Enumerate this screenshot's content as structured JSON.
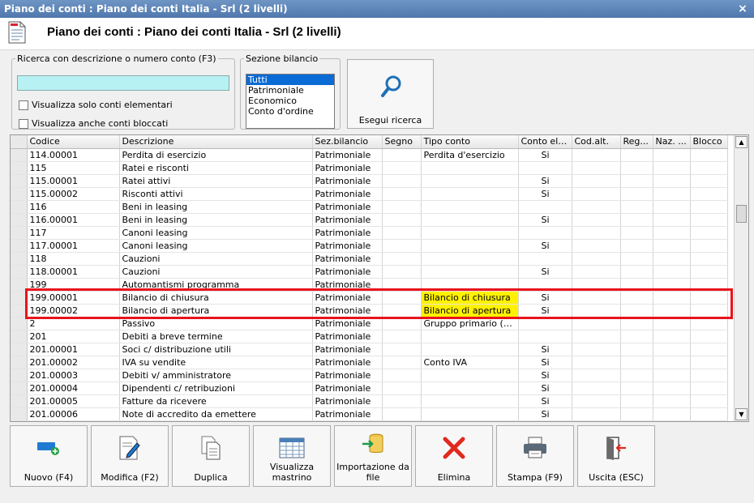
{
  "window": {
    "title": "Piano dei conti : Piano dei conti Italia - Srl (2 livelli)",
    "close_glyph": "×"
  },
  "header": {
    "title": "Piano dei conti : Piano dei conti Italia - Srl (2 livelli)"
  },
  "search": {
    "legend": "Ricerca con descrizione o numero conto (F3)",
    "value": "",
    "only_elementary_label": "Visualizza solo conti elementari",
    "show_blocked_label": "Visualizza anche conti bloccati"
  },
  "sezione": {
    "legend": "Sezione bilancio",
    "options": [
      "Tutti",
      "Patrimoniale",
      "Economico",
      "Conto d'ordine"
    ],
    "selected": "Tutti"
  },
  "search_button": {
    "label": "Esegui ricerca"
  },
  "table": {
    "columns": [
      "Codice",
      "Descrizione",
      "Sez.bilancio",
      "Segno",
      "Tipo conto",
      "Conto elem.",
      "Cod.alt.",
      "Reg...",
      "Naz. ...",
      "Blocco"
    ],
    "rows": [
      [
        "114.00001",
        "Perdita di esercizio",
        "Patrimoniale",
        "",
        "Perdita d'esercizio",
        "Si",
        "",
        "",
        "",
        ""
      ],
      [
        "115",
        "Ratei e risconti",
        "Patrimoniale",
        "",
        "",
        "",
        "",
        "",
        "",
        ""
      ],
      [
        "115.00001",
        "Ratei attivi",
        "Patrimoniale",
        "",
        "",
        "Si",
        "",
        "",
        "",
        ""
      ],
      [
        "115.00002",
        "Risconti attivi",
        "Patrimoniale",
        "",
        "",
        "Si",
        "",
        "",
        "",
        ""
      ],
      [
        "116",
        "Beni in leasing",
        "Patrimoniale",
        "",
        "",
        "",
        "",
        "",
        "",
        ""
      ],
      [
        "116.00001",
        "Beni in leasing",
        "Patrimoniale",
        "",
        "",
        "Si",
        "",
        "",
        "",
        ""
      ],
      [
        "117",
        "Canoni leasing",
        "Patrimoniale",
        "",
        "",
        "",
        "",
        "",
        "",
        ""
      ],
      [
        "117.00001",
        "Canoni leasing",
        "Patrimoniale",
        "",
        "",
        "Si",
        "",
        "",
        "",
        ""
      ],
      [
        "118",
        "Cauzioni",
        "Patrimoniale",
        "",
        "",
        "",
        "",
        "",
        "",
        ""
      ],
      [
        "118.00001",
        "Cauzioni",
        "Patrimoniale",
        "",
        "",
        "Si",
        "",
        "",
        "",
        ""
      ],
      [
        "199",
        "Automantismi programma",
        "Patrimoniale",
        "",
        "",
        "",
        "",
        "",
        "",
        ""
      ],
      [
        "199.00001",
        "Bilancio di chiusura",
        "Patrimoniale",
        "",
        "Bilancio di chiusura",
        "Si",
        "",
        "",
        "",
        ""
      ],
      [
        "199.00002",
        "Bilancio di apertura",
        "Patrimoniale",
        "",
        "Bilancio di apertura",
        "Si",
        "",
        "",
        "",
        ""
      ],
      [
        "2",
        "Passivo",
        "Patrimoniale",
        "",
        "Gruppo primario (atti...",
        "",
        "",
        "",
        "",
        ""
      ],
      [
        "201",
        "Debiti a breve termine",
        "Patrimoniale",
        "",
        "",
        "",
        "",
        "",
        "",
        ""
      ],
      [
        "201.00001",
        "Soci c/ distribuzione utili",
        "Patrimoniale",
        "",
        "",
        "Si",
        "",
        "",
        "",
        ""
      ],
      [
        "201.00002",
        "IVA su vendite",
        "Patrimoniale",
        "",
        "Conto IVA",
        "Si",
        "",
        "",
        "",
        ""
      ],
      [
        "201.00003",
        "Debiti v/ amministratore",
        "Patrimoniale",
        "",
        "",
        "Si",
        "",
        "",
        "",
        ""
      ],
      [
        "201.00004",
        "Dipendenti c/ retribuzioni",
        "Patrimoniale",
        "",
        "",
        "Si",
        "",
        "",
        "",
        ""
      ],
      [
        "201.00005",
        "Fatture da ricevere",
        "Patrimoniale",
        "",
        "",
        "Si",
        "",
        "",
        "",
        ""
      ],
      [
        "201.00006",
        "Note di accredito da emettere",
        "Patrimoniale",
        "",
        "",
        "Si",
        "",
        "",
        "",
        ""
      ]
    ],
    "highlight_rows": [
      11,
      12
    ]
  },
  "toolbar": {
    "buttons": [
      {
        "key": "nuovo",
        "label": "Nuovo (F4)"
      },
      {
        "key": "modifica",
        "label": "Modifica (F2)"
      },
      {
        "key": "duplica",
        "label": "Duplica"
      },
      {
        "key": "mastrino",
        "label": "Visualizza mastrino"
      },
      {
        "key": "importazione",
        "label": "Importazione da file"
      },
      {
        "key": "elimina",
        "label": "Elimina"
      },
      {
        "key": "stampa",
        "label": "Stampa (F9)"
      },
      {
        "key": "uscita",
        "label": "Uscita (ESC)"
      }
    ]
  },
  "colors": {
    "highlight": "#fff200",
    "selection_box": "#e8141b",
    "search_bg": "#b8f1f3",
    "list_selected": "#0b6bd6"
  }
}
